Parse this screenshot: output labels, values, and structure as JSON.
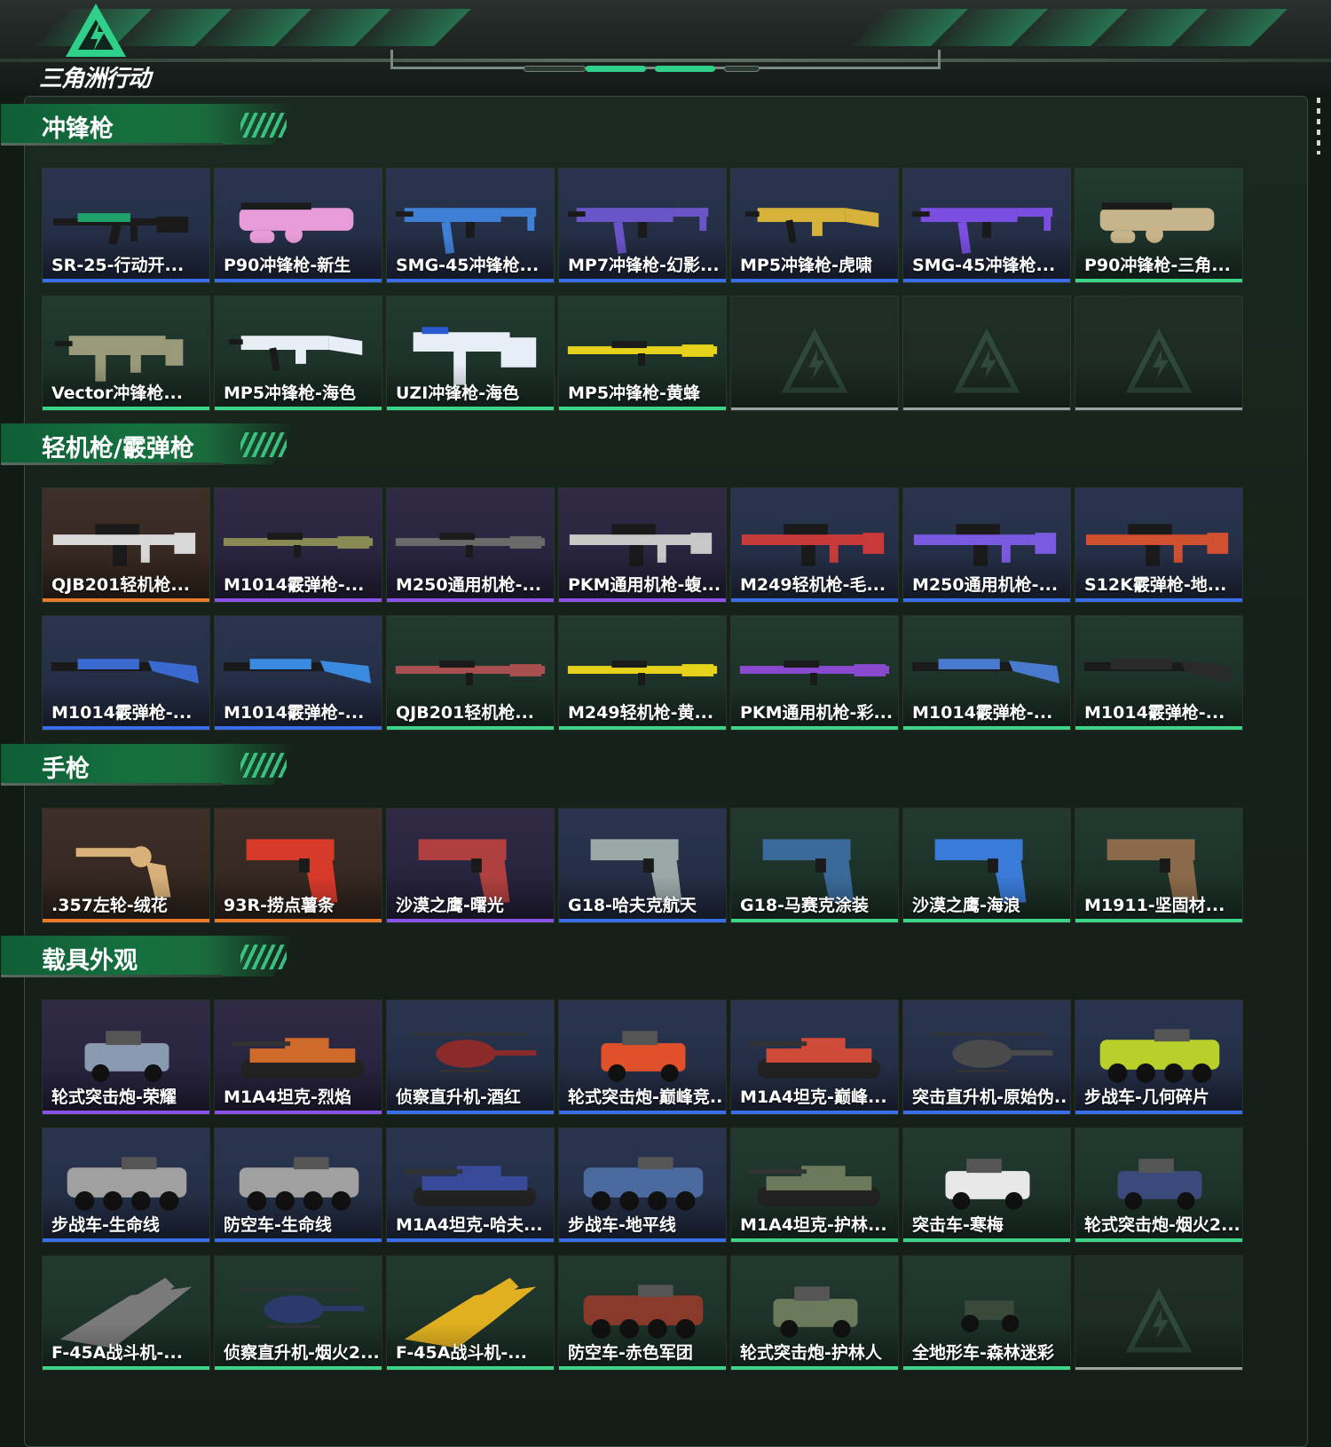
{
  "header": {
    "logo_text": "三角洲行动"
  },
  "sections": [
    {
      "title": "冲锋枪",
      "items": [
        {
          "name": "SR-25-行动开...",
          "rarity": "blue",
          "kind": "rifle",
          "color": "#1fa36a"
        },
        {
          "name": "P90冲锋枪-新生",
          "rarity": "blue",
          "kind": "p90",
          "color": "#e79bd8"
        },
        {
          "name": "SMG-45冲锋枪...",
          "rarity": "blue",
          "kind": "smg",
          "color": "#3f7fd6"
        },
        {
          "name": "MP7冲锋枪-幻影...",
          "rarity": "blue",
          "kind": "smg",
          "color": "#6a55c8"
        },
        {
          "name": "MP5冲锋枪-虎啸",
          "rarity": "blue",
          "kind": "mp5",
          "color": "#d6b23a"
        },
        {
          "name": "SMG-45冲锋枪...",
          "rarity": "blue",
          "kind": "smg",
          "color": "#7a4ee0"
        },
        {
          "name": "P90冲锋枪-三角...",
          "rarity": "green",
          "kind": "p90",
          "color": "#c8b48a"
        },
        {
          "name": "Vector冲锋枪...",
          "rarity": "green",
          "kind": "vector",
          "color": "#9a9a7a"
        },
        {
          "name": "MP5冲锋枪-海色",
          "rarity": "green",
          "kind": "mp5",
          "color": "#e8eef6"
        },
        {
          "name": "UZI冲锋枪-海色",
          "rarity": "green",
          "kind": "uzi",
          "color": "#e8eef6"
        },
        {
          "name": "MP5冲锋枪-黄蜂",
          "rarity": "green",
          "kind": "long",
          "color": "#e6d21a"
        },
        {
          "name": "",
          "rarity": "empty",
          "kind": "empty",
          "color": "#2a3a32"
        },
        {
          "name": "",
          "rarity": "empty",
          "kind": "empty",
          "color": "#2a3a32"
        },
        {
          "name": "",
          "rarity": "empty",
          "kind": "empty",
          "color": "#2a3a32"
        }
      ]
    },
    {
      "title": "轻机枪/霰弹枪",
      "items": [
        {
          "name": "QJB201轻机枪...",
          "rarity": "orange",
          "kind": "lmg",
          "color": "#d8d8d8"
        },
        {
          "name": "M1014霰弹枪-...",
          "rarity": "purple",
          "kind": "long",
          "color": "#8a8a55"
        },
        {
          "name": "M250通用机枪-...",
          "rarity": "purple",
          "kind": "long",
          "color": "#6a6a6a"
        },
        {
          "name": "PKM通用机枪-蝮...",
          "rarity": "purple",
          "kind": "lmg",
          "color": "#c8c8c8"
        },
        {
          "name": "M249轻机枪-毛...",
          "rarity": "blue",
          "kind": "lmg",
          "color": "#c83a3a"
        },
        {
          "name": "M250通用机枪-...",
          "rarity": "blue",
          "kind": "lmg",
          "color": "#7a5ae0"
        },
        {
          "name": "S12K霰弹枪-地...",
          "rarity": "blue",
          "kind": "lmg",
          "color": "#d05030"
        },
        {
          "name": "M1014霰弹枪-...",
          "rarity": "blue",
          "kind": "shotgun",
          "color": "#3a6ad0"
        },
        {
          "name": "M1014霰弹枪-...",
          "rarity": "blue",
          "kind": "shotgun",
          "color": "#3a8ae0"
        },
        {
          "name": "QJB201轻机枪...",
          "rarity": "green",
          "kind": "long",
          "color": "#a85050"
        },
        {
          "name": "M249轻机枪-黄...",
          "rarity": "green",
          "kind": "long",
          "color": "#e6d21a"
        },
        {
          "name": "PKM通用机枪-彩...",
          "rarity": "green",
          "kind": "long",
          "color": "#8a4ad0"
        },
        {
          "name": "M1014霰弹枪-...",
          "rarity": "green",
          "kind": "shotgun",
          "color": "#4a7ad0"
        },
        {
          "name": "M1014霰弹枪-...",
          "rarity": "green",
          "kind": "shotgun",
          "color": "#2a2a2a"
        }
      ]
    },
    {
      "title": "手枪",
      "items": [
        {
          "name": ".357左轮-绒花",
          "rarity": "orange",
          "kind": "revolver",
          "color": "#d8b07a"
        },
        {
          "name": "93R-捞点薯条",
          "rarity": "orange",
          "kind": "pistol",
          "color": "#d83a2a"
        },
        {
          "name": "沙漠之鹰-曙光",
          "rarity": "purple",
          "kind": "pistol",
          "color": "#b04040"
        },
        {
          "name": "G18-哈夫克航天",
          "rarity": "blue",
          "kind": "pistol",
          "color": "#9aa8a8"
        },
        {
          "name": "G18-马赛克涂装",
          "rarity": "green",
          "kind": "pistol",
          "color": "#3a6a9a"
        },
        {
          "name": "沙漠之鹰-海浪",
          "rarity": "green",
          "kind": "pistol",
          "color": "#3a7ad8"
        },
        {
          "name": "M1911-坚固材...",
          "rarity": "green",
          "kind": "pistol",
          "color": "#8a6a4a"
        }
      ]
    },
    {
      "title": "载具外观",
      "items": [
        {
          "name": "轮式突击炮-荣耀",
          "rarity": "purple",
          "kind": "jeep",
          "color": "#8a9ab0"
        },
        {
          "name": "M1A4坦克-烈焰",
          "rarity": "purple",
          "kind": "tank",
          "color": "#d06a2a"
        },
        {
          "name": "侦察直升机-酒红",
          "rarity": "blue",
          "kind": "heli",
          "color": "#8a2a2a"
        },
        {
          "name": "轮式突击炮-巅峰竞...",
          "rarity": "blue",
          "kind": "jeep",
          "color": "#e0502a"
        },
        {
          "name": "M1A4坦克-巅峰...",
          "rarity": "blue",
          "kind": "tank",
          "color": "#d04a3a"
        },
        {
          "name": "突击直升机-原始伪...",
          "rarity": "blue",
          "kind": "heli",
          "color": "#4a4a4a"
        },
        {
          "name": "步战车-几何碎片",
          "rarity": "blue",
          "kind": "apc",
          "color": "#b8d02a"
        },
        {
          "name": "步战车-生命线",
          "rarity": "blue",
          "kind": "apc",
          "color": "#a0a0a0"
        },
        {
          "name": "防空车-生命线",
          "rarity": "blue",
          "kind": "apc",
          "color": "#a0a0a0"
        },
        {
          "name": "M1A4坦克-哈夫...",
          "rarity": "blue",
          "kind": "tank",
          "color": "#3a4a9a"
        },
        {
          "name": "步战车-地平线",
          "rarity": "blue",
          "kind": "apc",
          "color": "#4a6aa0"
        },
        {
          "name": "M1A4坦克-护林...",
          "rarity": "green",
          "kind": "tank",
          "color": "#6a7a5a"
        },
        {
          "name": "突击车-寒梅",
          "rarity": "green",
          "kind": "jeep",
          "color": "#e8e8e8"
        },
        {
          "name": "轮式突击炮-烟火2...",
          "rarity": "green",
          "kind": "jeep",
          "color": "#3a4a7a"
        },
        {
          "name": "F-45A战斗机-...",
          "rarity": "green",
          "kind": "jet",
          "color": "#7a7a7a"
        },
        {
          "name": "侦察直升机-烟火2...",
          "rarity": "green",
          "kind": "heli",
          "color": "#2a3a6a"
        },
        {
          "name": "F-45A战斗机-...",
          "rarity": "green",
          "kind": "jet",
          "color": "#e0b020"
        },
        {
          "name": "防空车-赤色军团",
          "rarity": "green",
          "kind": "apc",
          "color": "#8a3a2a"
        },
        {
          "name": "轮式突击炮-护林人",
          "rarity": "green",
          "kind": "jeep",
          "color": "#6a7a5a"
        },
        {
          "name": "全地形车-森林迷彩",
          "rarity": "green",
          "kind": "atv",
          "color": "#3a4a3a"
        },
        {
          "name": "",
          "rarity": "empty",
          "kind": "empty",
          "color": "#2a3a32"
        }
      ]
    }
  ]
}
